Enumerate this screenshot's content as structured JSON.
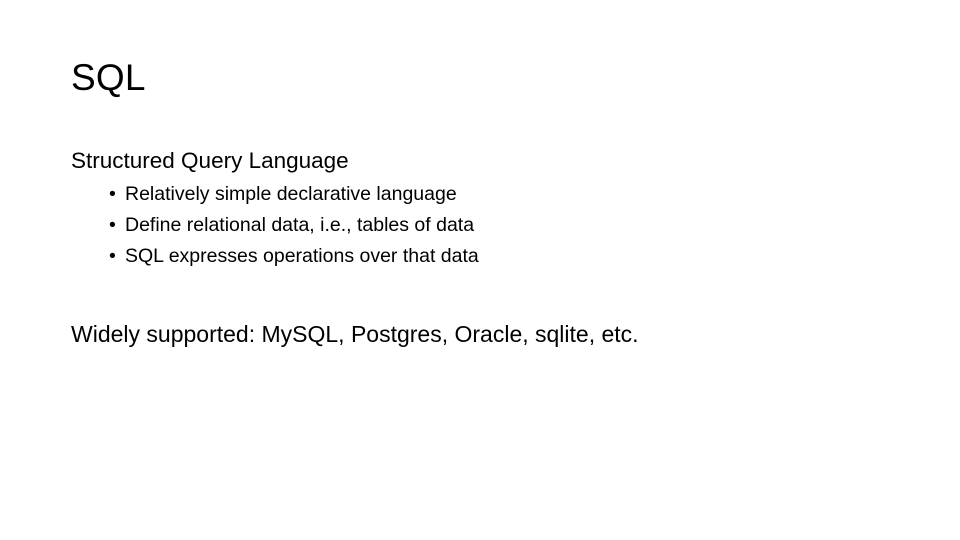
{
  "slide": {
    "title": "SQL",
    "heading": "Structured Query Language",
    "bullet_glyph": "•",
    "bullets": [
      {
        "text": "Relatively simple declarative language"
      },
      {
        "text": "Define relational data, i.e., tables of data"
      },
      {
        "text": "SQL expresses operations over that data"
      }
    ],
    "closing": "Widely supported: MySQL, Postgres, Oracle, sqlite, etc.",
    "colors": {
      "background": "#ffffff",
      "text": "#000000"
    }
  }
}
